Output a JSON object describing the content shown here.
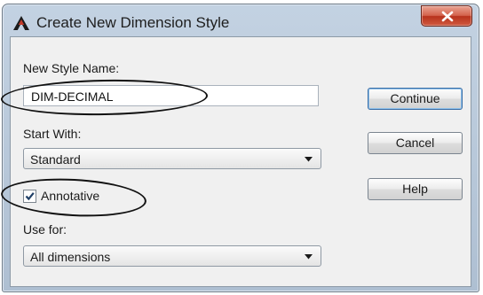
{
  "window": {
    "title": "Create New Dimension Style",
    "close_label": "x"
  },
  "form": {
    "new_style_name_label": "New Style Name:",
    "new_style_name_value": "DIM-DECIMAL",
    "start_with_label": "Start With:",
    "start_with_value": "Standard",
    "annotative_label": "Annotative",
    "annotative_checked": true,
    "use_for_label": "Use for:",
    "use_for_value": "All dimensions"
  },
  "buttons": {
    "continue": "Continue",
    "cancel": "Cancel",
    "help": "Help"
  },
  "icons": {
    "app": "autocad-a-icon",
    "close": "close-icon",
    "dropdown": "chevron-down-icon",
    "check": "check-icon"
  }
}
